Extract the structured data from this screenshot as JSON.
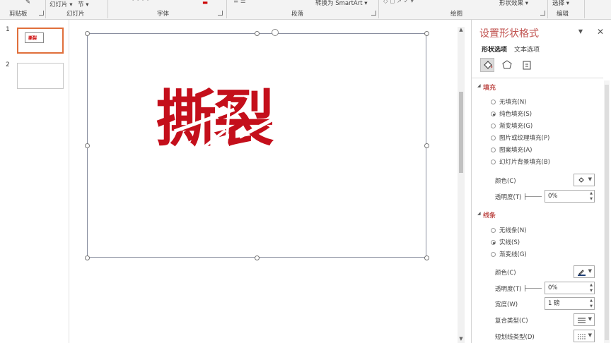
{
  "ribbon": {
    "groups": {
      "clipboard": "剪贴板",
      "slides": "幻灯片",
      "font": "字体",
      "paragraph": "段落",
      "drawing": "绘图",
      "editing": "编辑"
    },
    "new_slide_label": "幻灯片 ▾",
    "section_label": "节 ▾",
    "convert_smartart": "转换为 SmartArt ▾",
    "shape_effects": "形状效果 ▾",
    "select": "选择 ▾"
  },
  "thumbnails": [
    {
      "number": "1",
      "mini_text": "撕裂"
    },
    {
      "number": "2"
    }
  ],
  "slide": {
    "wordart_text": "撕裂",
    "text_color": "#c40f1b"
  },
  "format_pane": {
    "title": "设置形状格式",
    "tabs": [
      "形状选项",
      "文本选项"
    ],
    "fill": {
      "header": "填充",
      "options": [
        {
          "label": "无填充(N)",
          "selected": false
        },
        {
          "label": "纯色填充(S)",
          "selected": true
        },
        {
          "label": "渐变填充(G)",
          "selected": false
        },
        {
          "label": "图片或纹理填充(P)",
          "selected": false
        },
        {
          "label": "图案填充(A)",
          "selected": false
        },
        {
          "label": "幻灯片背景填充(B)",
          "selected": false
        }
      ],
      "color_label": "颜色(C)",
      "transparency_label": "透明度(T)",
      "transparency_value": "0%"
    },
    "line": {
      "header": "线条",
      "options": [
        {
          "label": "无线条(N)",
          "selected": false
        },
        {
          "label": "实线(S)",
          "selected": true
        },
        {
          "label": "渐变线(G)",
          "selected": false
        }
      ],
      "color_label": "颜色(C)",
      "transparency_label": "透明度(T)",
      "transparency_value": "0%",
      "width_label": "宽度(W)",
      "width_value": "1 磅",
      "compound_label": "复合类型(C)",
      "dash_label": "短划线类型(D)"
    }
  },
  "colors": {
    "accent": "#c0504d",
    "wordart": "#c40f1b",
    "thumb_selected": "#e06f3b"
  }
}
